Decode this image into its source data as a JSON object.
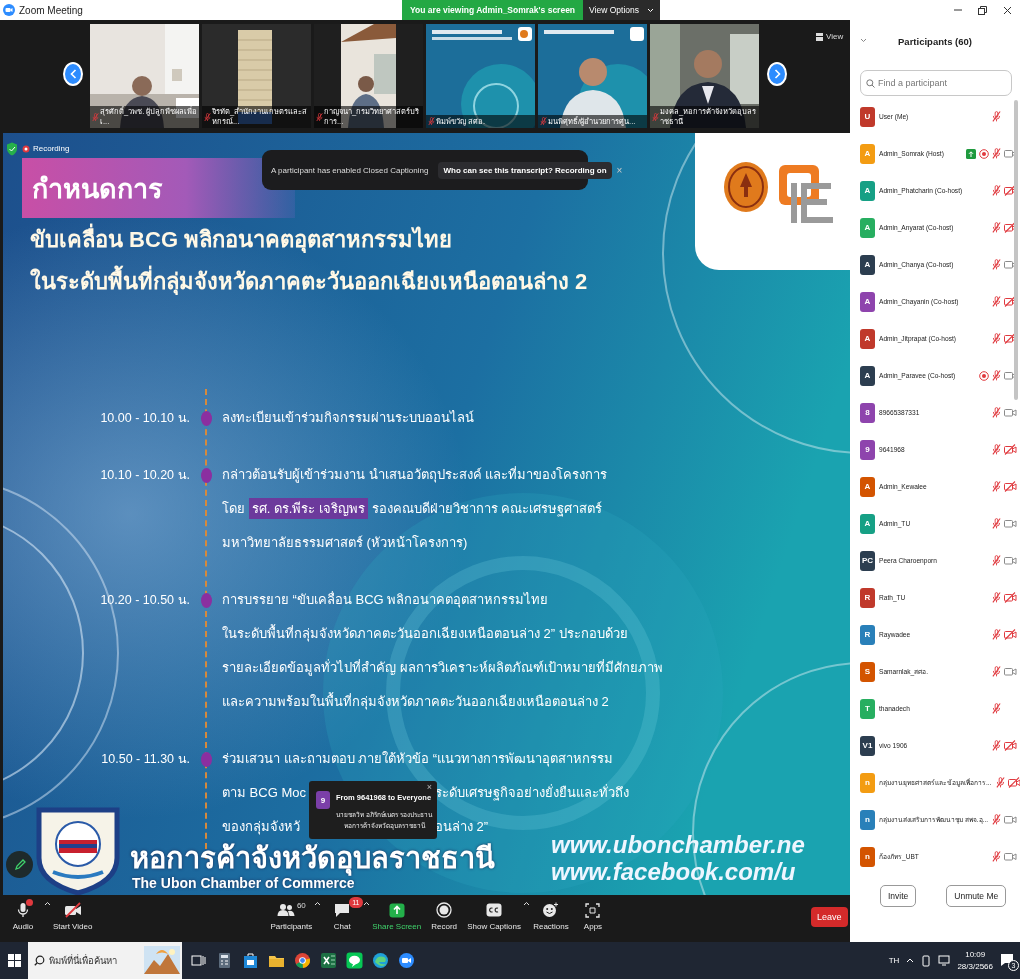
{
  "window": {
    "title": "Zoom Meeting"
  },
  "share_banner": {
    "text": "You are viewing Admin_Somrak's screen",
    "button": "View Options"
  },
  "video_strip": {
    "view_label": "View",
    "tiles": [
      {
        "name": "สุรศักดิ์_วพช. ผู้ปลูกพืชผลเพื่อเ...",
        "muted": true
      },
      {
        "name": "จิรทัต_สำนักงานเกษตรและสหกรณ์...",
        "muted": true
      },
      {
        "name": "กาญจนา_กรมวิทยาศาสตร์บริการ...",
        "muted": true
      },
      {
        "name": "พิมพ์ขวัญ สศอ.",
        "muted": true
      },
      {
        "name": "มนพิศุทธิ์/ผู้อำนวยการศูน...",
        "muted": true
      },
      {
        "name": "มงคล_หอการค้าจังหวัดอุบลราชธานี",
        "muted": true
      }
    ]
  },
  "slide": {
    "recording_label": "Recording",
    "caption_notice": {
      "text": "A participant has enabled Closed Captioning",
      "link": "Who can see this transcript? Recording on",
      "close": "×"
    },
    "heading": "กำหนดการ",
    "title_lines": [
      "ขับเคลื่อน BCG พลิกอนาคตอุตสาหกรรมไทย",
      "ในระดับพื้นที่กลุ่มจังหวัดภาคตะวันออกเฉียงเหนือตอนล่าง 2"
    ],
    "agenda": [
      {
        "time": "10.00 - 10.10 น.",
        "lines": [
          [
            "ลงทะเบียนเข้าร่วมกิจกรรมผ่านระบบออนไลน์"
          ]
        ]
      },
      {
        "time": "10.10 - 10.20 น.",
        "lines": [
          [
            "กล่าวต้อนรับผู้เข้าร่วมงาน นำเสนอวัตถุประสงค์ และที่มาของโครงการ"
          ],
          [
            "โดย **รศ. ดร.พีระ เจริญพร** รองคณบดีฝ่ายวิชาการ คณะเศรษฐศาสตร์"
          ],
          [
            "มหาวิทยาลัยธรรมศาสตร์ (หัวหน้าโครงการ)"
          ]
        ]
      },
      {
        "time": "10.20 - 10.50 น.",
        "lines": [
          [
            "การบรรยาย “ขับเคลื่อน BCG พลิกอนาคตอุตสาหกรรมไทย"
          ],
          [
            "ในระดับพื้นที่กลุ่มจังหวัดภาคตะวันออกเฉียงเหนือตอนล่าง 2” ประกอบด้วย"
          ],
          [
            "รายละเอียดข้อมูลทั่วไปที่สำคัญ ผลการวิเคราะห์ผลิตภัณฑ์เป้าหมายที่มีศักยภาพ"
          ],
          [
            "และความพร้อมในพื้นที่กลุ่มจังหวัดภาคตะวันออกเฉียงเหนือตอนล่าง 2"
          ]
        ]
      },
      {
        "time": "10.50 - 11.30 น.",
        "lines": [
          [
            "ร่วมเสวนา และถามตอบ ภายใต้หัวข้อ “แนวทางการพัฒนาอุตสาหกรรม"
          ],
          [
            "ตาม BCG Moc",
            "ระดับเศรษฐกิจอย่างยั่งยืนและทั่วถึง"
          ],
          [
            "ของกลุ่มจังหวั",
            "อนล่าง 2”"
          ]
        ]
      }
    ],
    "banner": {
      "org_thai": "หอการค้าจังหวัดอุบลราชธานี",
      "org_english": "The Ubon Chamber of Commerce",
      "urls": [
        "www.ubonchamber.ne",
        "www.facebook.com/u"
      ]
    }
  },
  "chat_popup": {
    "avatar": "9",
    "color": "#7b3fa8",
    "title": "From 9641968 to Everyone",
    "message": "นายชลวิท อภิรักษ์เนตร รองประธาน หอการค้าจังหวัดอุบลราชธานี",
    "close": "×"
  },
  "toolbar": {
    "items": [
      {
        "kind": "audio",
        "label": "Audio",
        "caret": true,
        "alert": true
      },
      {
        "kind": "video",
        "label": "Start Video",
        "caret": false
      },
      {
        "kind": "participants",
        "label": "Participants",
        "count": "60",
        "caret": true
      },
      {
        "kind": "chat",
        "label": "Chat",
        "badge": "11",
        "caret": true
      },
      {
        "kind": "share",
        "label": "Share Screen",
        "caret": false
      },
      {
        "kind": "record",
        "label": "Record",
        "caret": false
      },
      {
        "kind": "captions",
        "label": "Show Captions",
        "caret": true
      },
      {
        "kind": "reactions",
        "label": "Reactions",
        "caret": false
      },
      {
        "kind": "apps",
        "label": "Apps",
        "caret": false
      }
    ],
    "leave": "Leave"
  },
  "participants": {
    "title": "Participants (60)",
    "search_placeholder": "Find a participant",
    "rows": [
      {
        "avatar": "U",
        "color": "#c0392b",
        "name": "User (Me)",
        "sharing": false,
        "recording": false,
        "muted": true
      },
      {
        "avatar": "A",
        "color": "#f39c12",
        "name": "Admin_Somrak (Host)",
        "sharing": true,
        "recording": true,
        "muted": true,
        "video_off": false
      },
      {
        "avatar": "A",
        "color": "#16a085",
        "name": "Admin_Phatcharin (Co-host)",
        "sharing": false,
        "recording": false,
        "muted": true,
        "video_off": true
      },
      {
        "avatar": "A",
        "color": "#27ae60",
        "name": "Admin_Anyarat (Co-host)",
        "sharing": false,
        "recording": false,
        "muted": true,
        "video_off": true
      },
      {
        "avatar": "A",
        "color": "#2c3e50",
        "name": "Admin_Chanya (Co-host)",
        "sharing": false,
        "recording": false,
        "muted": true,
        "video_off": false
      },
      {
        "avatar": "A",
        "color": "#8e44ad",
        "name": "Admin_Chayanin (Co-host)",
        "sharing": false,
        "recording": false,
        "muted": true,
        "video_off": true
      },
      {
        "avatar": "A",
        "color": "#c0392b",
        "name": "Admin_Jitprapat (Co-host)",
        "sharing": false,
        "recording": false,
        "muted": true,
        "video_off": true
      },
      {
        "avatar": "A",
        "color": "#2c3e50",
        "name": "Admin_Paravee (Co-host)",
        "sharing": false,
        "recording": true,
        "muted": true,
        "video_off": false
      },
      {
        "avatar": "8",
        "color": "#8e44ad",
        "name": "89665387331",
        "sharing": false,
        "recording": false,
        "muted": true,
        "video_off": false
      },
      {
        "avatar": "9",
        "color": "#8e44ad",
        "name": "9641968",
        "sharing": false,
        "recording": false,
        "muted": true,
        "video_off": true
      },
      {
        "avatar": "A",
        "color": "#d35400",
        "name": "Admin_Kewalee",
        "sharing": false,
        "recording": false,
        "muted": true,
        "video_off": true
      },
      {
        "avatar": "A",
        "color": "#16a085",
        "name": "Admin_TU",
        "sharing": false,
        "recording": false,
        "muted": true,
        "video_off": false
      },
      {
        "avatar": "PC",
        "color": "#2c3e50",
        "name": "Peera Charoenporn",
        "sharing": false,
        "recording": false,
        "muted": true,
        "video_off": false
      },
      {
        "avatar": "R",
        "color": "#c0392b",
        "name": "Rath_TU",
        "sharing": false,
        "recording": false,
        "muted": true,
        "video_off": true
      },
      {
        "avatar": "R",
        "color": "#2980b9",
        "name": "Raywadee",
        "sharing": false,
        "recording": false,
        "muted": true,
        "video_off": true
      },
      {
        "avatar": "S",
        "color": "#d35400",
        "name": "Samarnlak_สศอ.",
        "sharing": false,
        "recording": false,
        "muted": true,
        "video_off": false
      },
      {
        "avatar": "T",
        "color": "#27ae60",
        "name": "thanadech",
        "sharing": false,
        "recording": false,
        "muted": true
      },
      {
        "avatar": "V1",
        "color": "#2c3e50",
        "name": "vivo 1906",
        "sharing": false,
        "recording": false,
        "muted": true,
        "video_off": true
      },
      {
        "avatar": "n",
        "color": "#f39c12",
        "name": "กลุ่มงานยุทธศาสตร์และข้อมูลเพื่อการ...",
        "sharing": false,
        "recording": false,
        "muted": true,
        "video_off": true
      },
      {
        "avatar": "n",
        "color": "#2980b9",
        "name": "กลุ่มงานส่งเสริมการพัฒนาชุม สพจ.อุ...",
        "sharing": false,
        "recording": false,
        "muted": true,
        "video_off": false
      },
      {
        "avatar": "n",
        "color": "#d35400",
        "name": "ก้องภัทร_UBT",
        "sharing": false,
        "recording": false,
        "muted": true,
        "video_off": false
      }
    ],
    "buttons": [
      "Invite",
      "Unmute Me"
    ]
  },
  "taskbar": {
    "search_placeholder": "พิมพ์ที่นี่เพื่อค้นหา",
    "language": "TH",
    "time": "10:09",
    "date": "28/3/2566",
    "notifications": "3"
  }
}
